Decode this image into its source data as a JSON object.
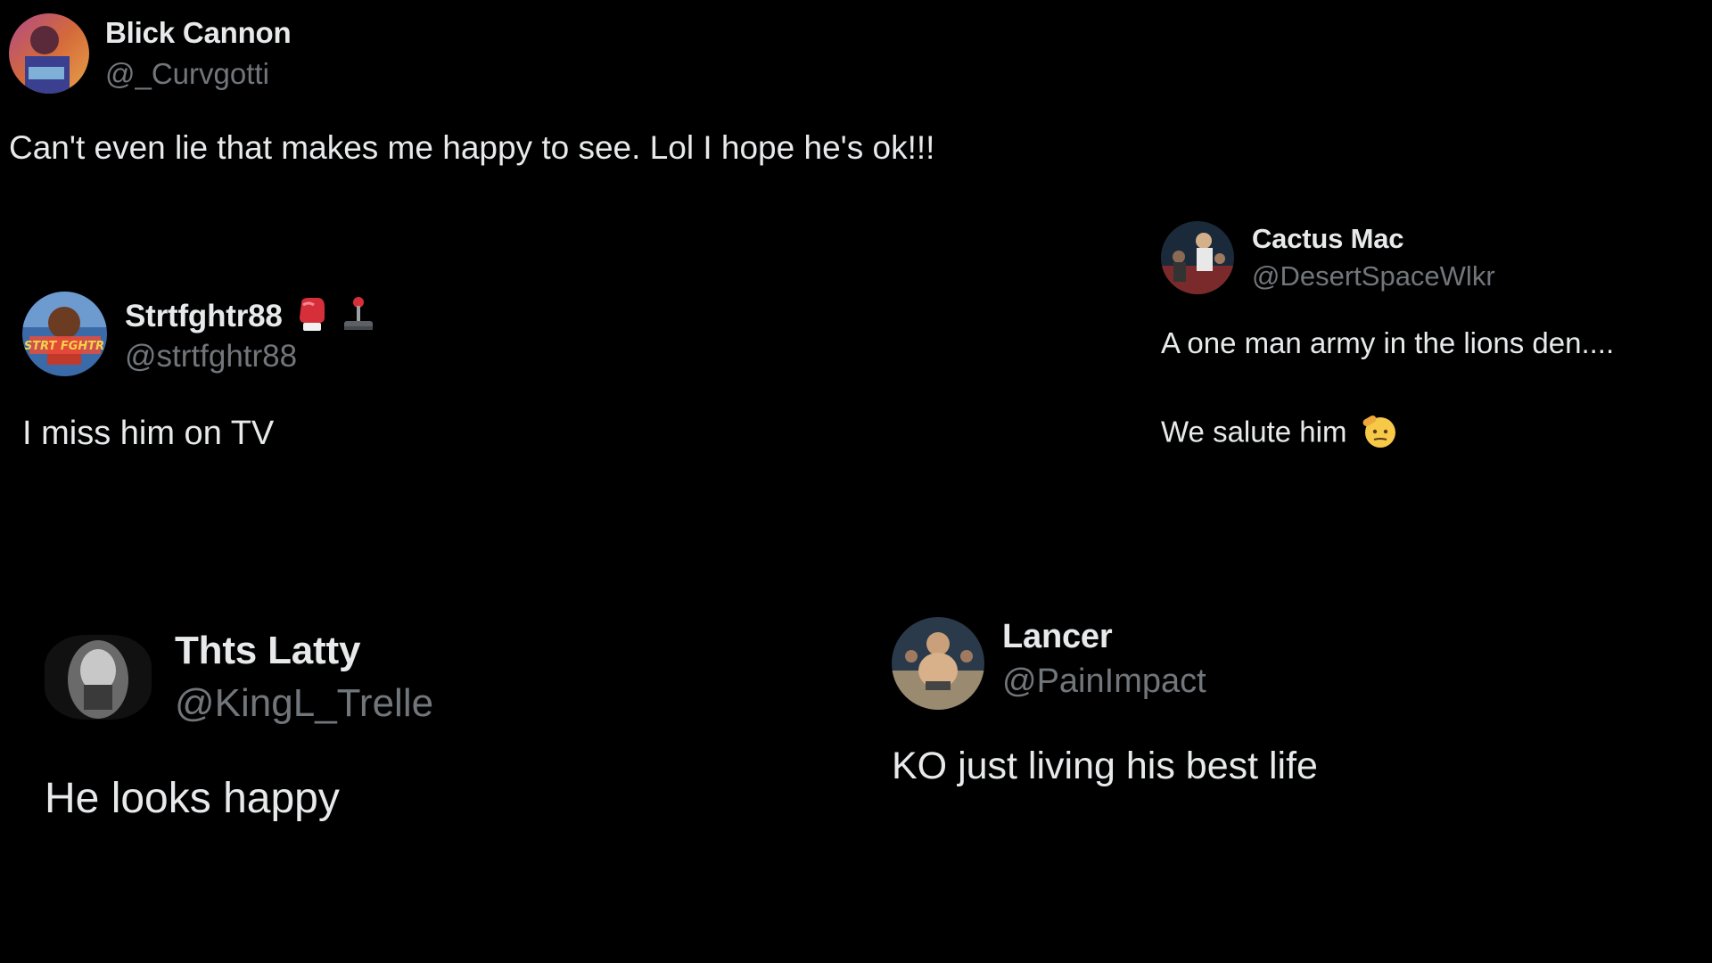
{
  "colors": {
    "background": "#000000",
    "primary_text": "#e7e9ea",
    "secondary_text": "#71767b"
  },
  "tweets": [
    {
      "display_name": "Blick Cannon",
      "handle": "@_Curvgotti",
      "text_lines": [
        "Can't even lie that makes me happy to see. Lol I hope he's ok!!!"
      ]
    },
    {
      "display_name": "Strtfghtr88",
      "handle": "@strtfghtr88",
      "name_emojis": [
        "boxing-glove-icon",
        "joystick-icon"
      ],
      "avatar_text": "STRT FGHTR",
      "text_lines": [
        "I miss him on TV"
      ]
    },
    {
      "display_name": "Cactus Mac",
      "handle": "@DesertSpaceWlkr",
      "text_lines": [
        "A one man army in the lions den....",
        "We salute him"
      ],
      "text_emoji": "saluting-face-icon"
    },
    {
      "display_name": "Thts Latty",
      "handle": "@KingL_Trelle",
      "text_lines": [
        "He looks happy"
      ]
    },
    {
      "display_name": "Lancer",
      "handle": "@PainImpact",
      "text_lines": [
        "KO just living his best life"
      ]
    }
  ]
}
